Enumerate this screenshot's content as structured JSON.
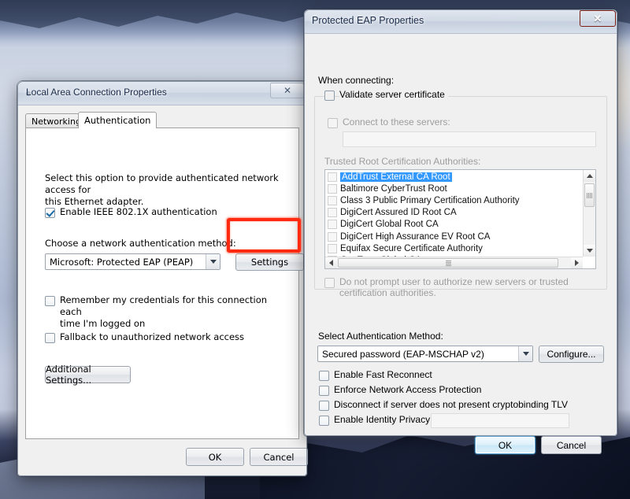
{
  "desktop": {
    "name": "windows-desktop-wallpaper"
  },
  "eap_dialog": {
    "title": "Protected EAP Properties",
    "close_label": "Close",
    "when_connecting_label": "When connecting:",
    "validate_server_certificate": "Validate server certificate",
    "connect_to_these_servers": "Connect to these servers:",
    "servers_field_value": "",
    "trusted_root_label": "Trusted Root Certification Authorities:",
    "certificates": [
      {
        "name": "AddTrust External CA Root",
        "checked": false,
        "selected": true
      },
      {
        "name": "Baltimore CyberTrust Root",
        "checked": false,
        "selected": false
      },
      {
        "name": "Class 3 Public Primary Certification Authority",
        "checked": false,
        "selected": false
      },
      {
        "name": "DigiCert Assured ID Root CA",
        "checked": false,
        "selected": false
      },
      {
        "name": "DigiCert Global Root CA",
        "checked": false,
        "selected": false
      },
      {
        "name": "DigiCert High Assurance EV Root CA",
        "checked": false,
        "selected": false
      },
      {
        "name": "Equifax Secure Certificate Authority",
        "checked": false,
        "selected": false
      },
      {
        "name": "GeoTrust Global CA",
        "checked": false,
        "selected": false
      }
    ],
    "do_not_prompt": "Do not prompt user to authorize new servers or trusted certification authorities.",
    "select_auth_method_label": "Select Authentication Method:",
    "auth_method_value": "Secured password (EAP-MSCHAP v2)",
    "configure_button": "Configure...",
    "enable_fast_reconnect": "Enable Fast Reconnect",
    "enforce_nap": "Enforce Network Access Protection",
    "disconnect_cryptobinding": "Disconnect if server does not present cryptobinding TLV",
    "enable_identity_privacy": "Enable Identity Privacy",
    "identity_privacy_value": "",
    "ok_button": "OK",
    "cancel_button": "Cancel"
  },
  "lac_dialog": {
    "title": "Local Area Connection Properties",
    "close_label": "Close",
    "tabs": [
      {
        "label": "Networking",
        "active": false
      },
      {
        "label": "Authentication",
        "active": true
      }
    ],
    "description_line1": "Select this option to provide authenticated network access for",
    "description_line2": "this Ethernet adapter.",
    "enable_8021x": "Enable IEEE 802.1X authentication",
    "choose_method_label": "Choose a network authentication method:",
    "auth_method_value": "Microsoft: Protected EAP (PEAP)",
    "settings_button": "Settings",
    "remember_credentials_line1": "Remember my credentials for this connection each",
    "remember_credentials_line2": "time I'm logged on",
    "fallback_unauthorized": "Fallback to unauthorized network access",
    "additional_settings_button": "Additional Settings...",
    "ok_button": "OK",
    "cancel_button": "Cancel"
  },
  "annotation": {
    "name": "red-highlight-box",
    "color": "#ff2a10",
    "target": "Settings"
  }
}
